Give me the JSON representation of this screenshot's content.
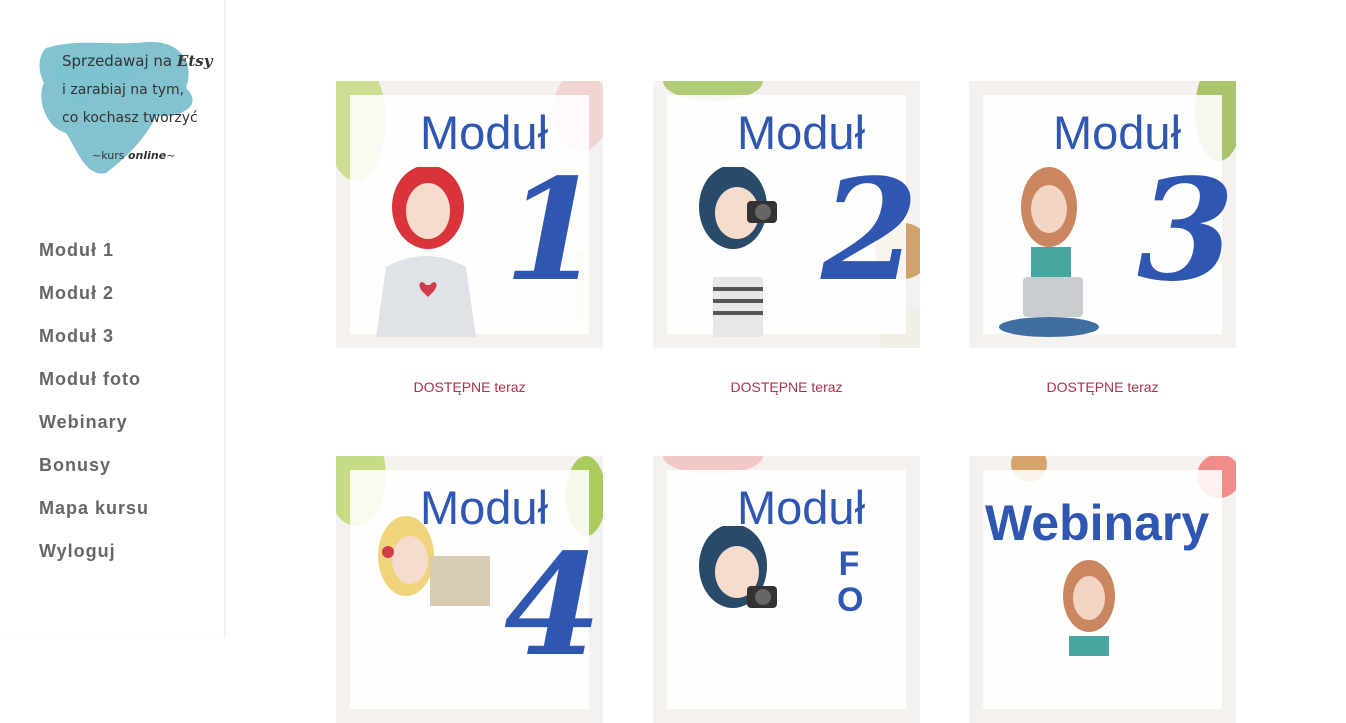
{
  "logo": {
    "line1_prefix": "Sprzedawaj na ",
    "line1_brand": "Etsy",
    "line2": "i zarabiaj na tym,",
    "line3": "co kochasz tworzyć",
    "line4_prefix": "~kurs ",
    "line4_emph": "online",
    "line4_suffix": "~",
    "splash_color": "#5aaebf"
  },
  "nav": {
    "items": [
      {
        "label": "Moduł 1"
      },
      {
        "label": "Moduł 2"
      },
      {
        "label": "Moduł 3"
      },
      {
        "label": "Moduł foto"
      },
      {
        "label": "Webinary"
      },
      {
        "label": "Bonusy"
      },
      {
        "label": "Mapa kursu"
      },
      {
        "label": "Wyloguj"
      }
    ]
  },
  "tiles": [
    {
      "word": "Moduł",
      "number": "1",
      "caption": "DOSTĘPNE teraz"
    },
    {
      "word": "Moduł",
      "number": "2",
      "caption": "DOSTĘPNE teraz"
    },
    {
      "word": "Moduł",
      "number": "3",
      "caption": "DOSTĘPNE teraz"
    },
    {
      "word": "Moduł",
      "number": "4"
    },
    {
      "word": "Moduł",
      "vertical_text": "FO"
    },
    {
      "word": "Webinary"
    }
  ],
  "colors": {
    "accent_blue": "#2f56b0",
    "caption_red": "#a8344a",
    "nav_text": "#666666"
  }
}
